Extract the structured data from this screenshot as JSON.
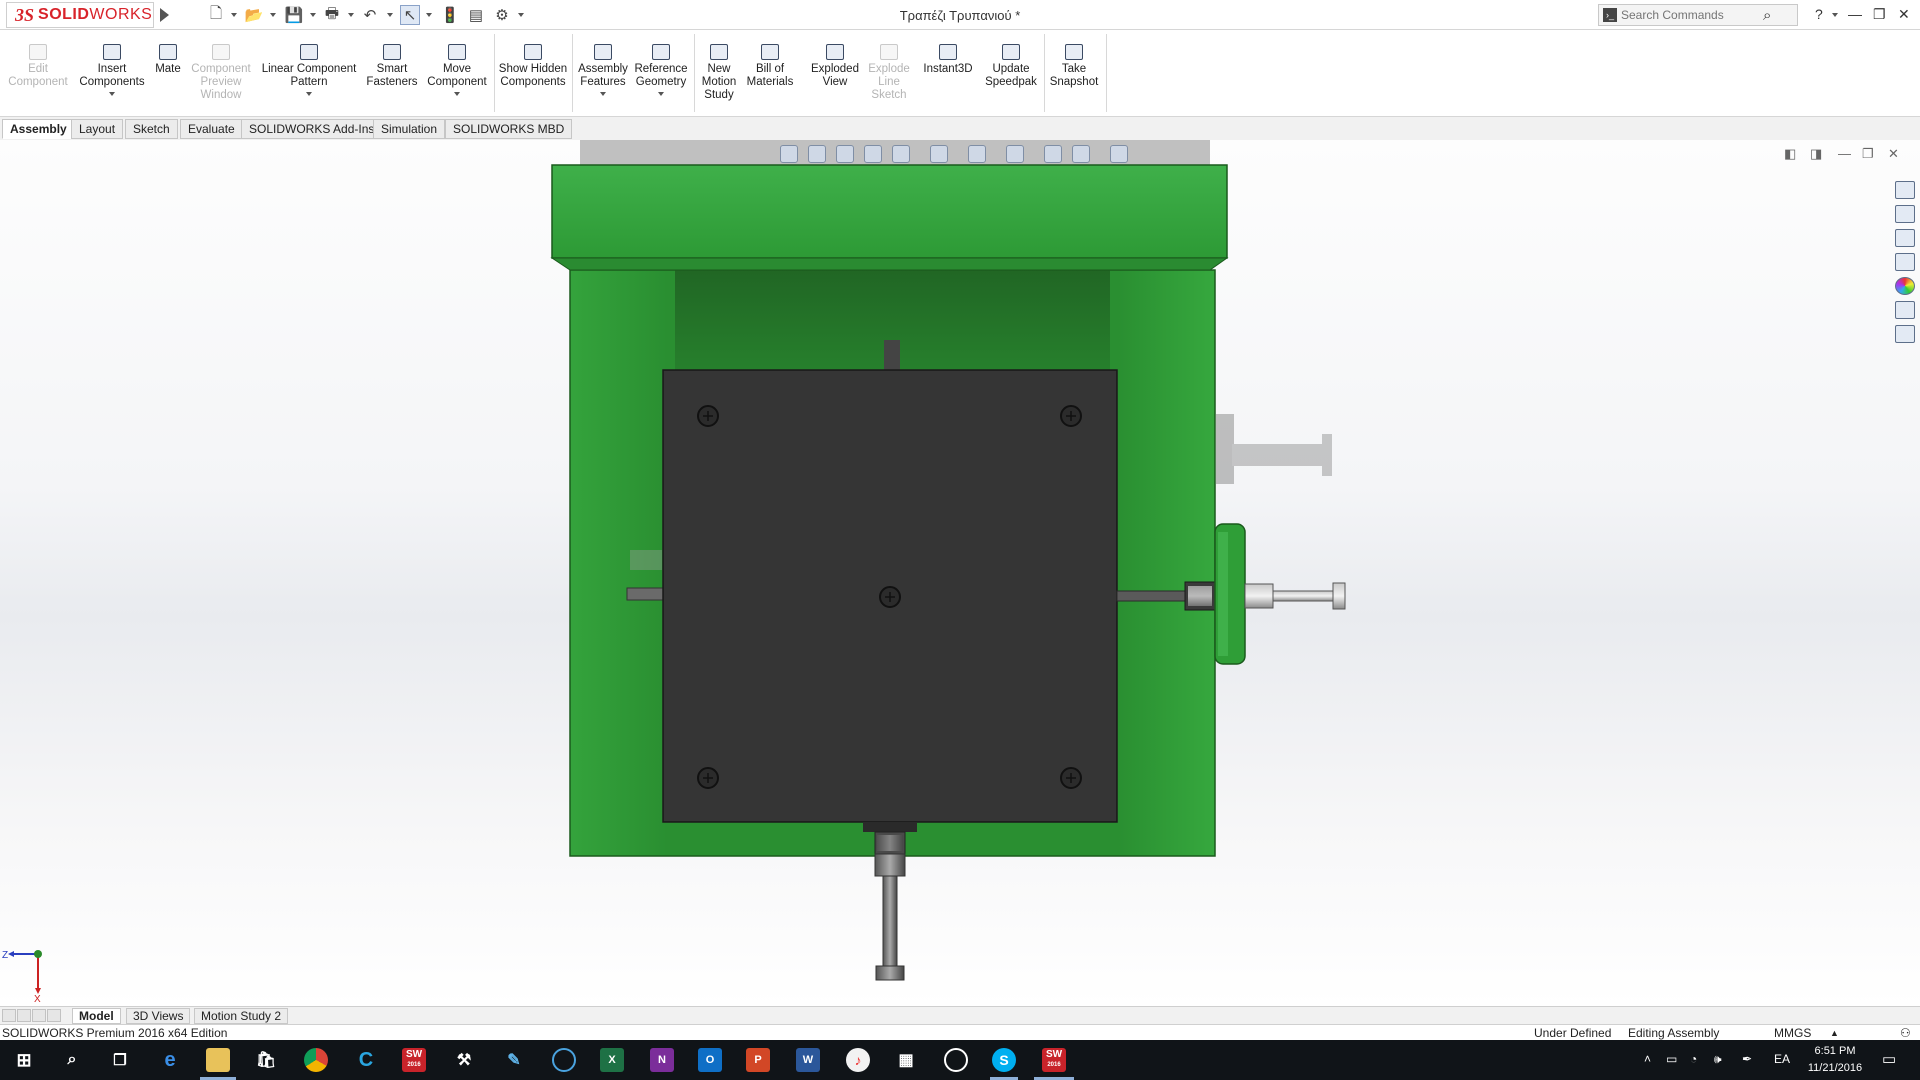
{
  "app": {
    "logo_ds": "3S",
    "logo_solid": "SOLID",
    "logo_works": "WORKS",
    "document_title": "Τραπέζι Τρυπανιού *"
  },
  "search": {
    "placeholder": "Search Commands",
    "value": ""
  },
  "help": {
    "label": "?"
  },
  "ribbon": {
    "buttons": [
      {
        "label": "Edit Component",
        "enabled": false
      },
      {
        "label": "Insert Components",
        "enabled": true
      },
      {
        "label": "Mate",
        "enabled": true
      },
      {
        "label": "Component Preview Window",
        "enabled": false
      },
      {
        "label": "Linear Component Pattern",
        "enabled": true
      },
      {
        "label": "Smart Fasteners",
        "enabled": true
      },
      {
        "label": "Move Component",
        "enabled": true
      },
      {
        "label": "Show Hidden Components",
        "enabled": true
      },
      {
        "label": "Assembly Features",
        "enabled": true
      },
      {
        "label": "Reference Geometry",
        "enabled": true
      },
      {
        "label": "New Motion Study",
        "enabled": true
      },
      {
        "label": "Bill of Materials",
        "enabled": true
      },
      {
        "label": "Exploded View",
        "enabled": true
      },
      {
        "label": "Explode Line Sketch",
        "enabled": false
      },
      {
        "label": "Instant3D",
        "enabled": true
      },
      {
        "label": "Update Speedpak",
        "enabled": true
      },
      {
        "label": "Take Snapshot",
        "enabled": true
      }
    ]
  },
  "tabs": [
    "Assembly",
    "Layout",
    "Sketch",
    "Evaluate",
    "SOLIDWORKS Add-Ins",
    "Simulation",
    "SOLIDWORKS MBD"
  ],
  "active_tab": "Assembly",
  "bottom_tabs": [
    "Model",
    "3D Views",
    "Motion Study 2"
  ],
  "active_bottom_tab": "Model",
  "status": {
    "edition": "SOLIDWORKS Premium 2016 x64 Edition",
    "definition": "Under Defined",
    "mode": "Editing Assembly",
    "units": "MMGS"
  },
  "triad": {
    "z": "Z",
    "x": "X"
  },
  "taskbar": {
    "sw_label": "SW",
    "sw_year": "2016",
    "excel_label": "X",
    "onenote_label": "N",
    "outlook_label": "O",
    "ppt_label": "P",
    "word_label": "W",
    "language": "EA",
    "time": "6:51 PM",
    "date": "11/21/2016"
  },
  "colors": {
    "model_green": "#33a33a",
    "model_dark": "#333333",
    "brand_red": "#d8232a",
    "taskbar": "#101418"
  },
  "icons": [
    "new-document-icon",
    "open-icon",
    "save-icon",
    "print-icon",
    "undo-icon",
    "select-icon",
    "rebuild-icon",
    "file-properties-icon",
    "options-icon",
    "zoom-to-fit-icon",
    "zoom-to-area-icon",
    "previous-view-icon",
    "section-view-icon",
    "view-orientation-icon",
    "display-style-icon",
    "hide-show-icon",
    "edit-appearance-icon",
    "scene-icon",
    "view-settings-icon",
    "home-icon",
    "design-library-icon",
    "file-explorer-icon",
    "view-palette-icon",
    "appearances-icon",
    "custom-properties-icon",
    "forum-icon",
    "windows-start-icon",
    "search-taskbar-icon",
    "task-view-icon",
    "edge-icon",
    "file-explorer-taskbar-icon",
    "store-icon",
    "chrome-icon",
    "ccleaner-icon",
    "solidworks-taskbar-icon",
    "notification-icon"
  ]
}
